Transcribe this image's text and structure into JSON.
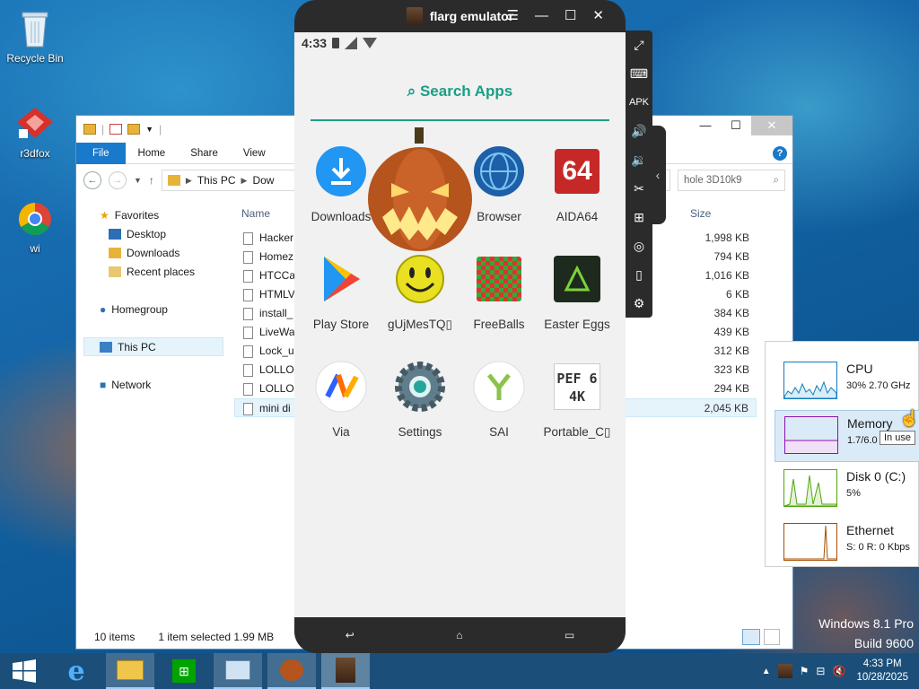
{
  "desktop": {
    "icons": [
      {
        "label": "Recycle Bin",
        "icon": "recycle-bin-icon"
      },
      {
        "label": "r3dfox",
        "icon": "r3dfox-icon"
      },
      {
        "label": "wi",
        "icon": "chrome-icon"
      }
    ]
  },
  "explorer": {
    "ribbon": {
      "file": "File",
      "home": "Home",
      "share": "Share",
      "view": "View"
    },
    "address": {
      "this_pc": "This PC",
      "partial": "Dow"
    },
    "search": {
      "text": "hole 3D10k9"
    },
    "nav": {
      "favorites": "Favorites",
      "desktop": "Desktop",
      "downloads": "Downloads",
      "recent": "Recent places",
      "homegroup": "Homegroup",
      "this_pc": "This PC",
      "network": "Network"
    },
    "columns": {
      "name": "Name",
      "size": "Size"
    },
    "files": [
      {
        "name": "Hacker",
        "size": "1,998 KB"
      },
      {
        "name": "Homez",
        "size": "794 KB"
      },
      {
        "name": "HTCCa",
        "size": "1,016 KB"
      },
      {
        "name": "HTMLV",
        "size": "6 KB"
      },
      {
        "name": "install_",
        "size": "384 KB"
      },
      {
        "name": "LiveWa",
        "size": "439 KB"
      },
      {
        "name": "Lock_u",
        "size": "312 KB"
      },
      {
        "name": "LOLLO",
        "size": "323 KB"
      },
      {
        "name": "LOLLO",
        "size": "294 KB"
      },
      {
        "name": "mini di",
        "size": "2,045 KB"
      }
    ],
    "status": {
      "count": "10 items",
      "selected": "1 item selected  1.99 MB"
    }
  },
  "emulator": {
    "title": "flarg emulator",
    "time": "4:33",
    "search_label": "Search Apps",
    "apps": [
      {
        "label": "Downloads",
        "icon": "download-icon"
      },
      {
        "label": "Browser",
        "icon": "globe-icon"
      },
      {
        "label": "AIDA64",
        "icon": "aida64-icon",
        "badge": "64"
      },
      {
        "label": "Play Store",
        "icon": "play-store-icon"
      },
      {
        "label": "gUjMesTQ▯",
        "icon": "smiley-icon"
      },
      {
        "label": "FreeBalls",
        "icon": "balls-grid-icon"
      },
      {
        "label": "Easter Eggs",
        "icon": "easter-eggs-icon"
      },
      {
        "label": "Via",
        "icon": "via-icon"
      },
      {
        "label": "Settings",
        "icon": "settings-gear-icon"
      },
      {
        "label": "SAI",
        "icon": "sai-icon"
      },
      {
        "label": "Portable_C▯",
        "icon": "portable-icon",
        "badge": "PEF 64K"
      }
    ]
  },
  "task_manager": {
    "items": [
      {
        "name": "CPU",
        "value": "30%  2.70 GHz",
        "color": "#117dbb"
      },
      {
        "name": "Memory",
        "value": "1.7/6.0",
        "color": "#8b12ae"
      },
      {
        "name": "Disk 0 (C:)",
        "value": "5%",
        "color": "#4da60c"
      },
      {
        "name": "Ethernet",
        "value": "S: 0  R: 0 Kbps",
        "color": "#a74f01"
      }
    ],
    "tooltip": "In use"
  },
  "watermark": {
    "line1": "Windows 8.1 Pro",
    "line2": "Build 9600"
  },
  "taskbar": {
    "time": "4:33 PM",
    "date": "10/28/2025"
  }
}
